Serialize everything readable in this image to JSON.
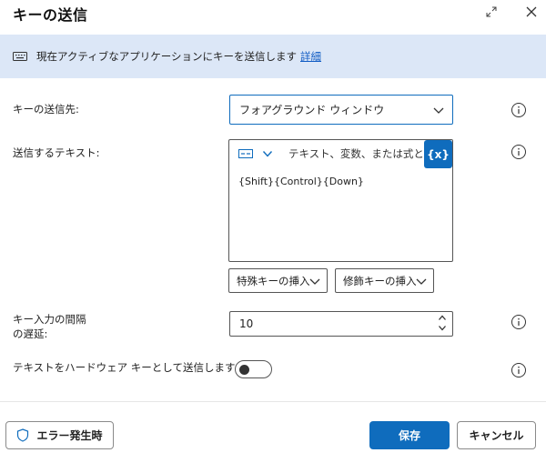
{
  "dialog": {
    "title": "キーの送信"
  },
  "banner": {
    "text": "現在アクティブなアプリケーションにキーを送信します",
    "link": "詳細"
  },
  "fields": {
    "send_target": {
      "label": "キーの送信先:",
      "value": "フォアグラウンド ウィンドウ"
    },
    "text_to_send": {
      "label": "送信するテキスト:",
      "placeholder": "テキスト、変数、または式として入力",
      "value": "{Shift}{Control}{Down}",
      "var_button": "{x}",
      "special_key_dropdown": "特殊キーの挿入",
      "modifier_key_dropdown": "修飾キーの挿入"
    },
    "delay": {
      "label_line1": "キー入力の間隔",
      "label_line2": "の遅延:",
      "value": "10"
    },
    "hardware_keys": {
      "label": "テキストをハードウェア キーとして送信します:",
      "enabled": false
    }
  },
  "footer": {
    "error_button": "エラー発生時",
    "save_button": "保存",
    "cancel_button": "キャンセル"
  },
  "colors": {
    "accent": "#0f6cbd",
    "banner_bg": "#dce7f7"
  }
}
